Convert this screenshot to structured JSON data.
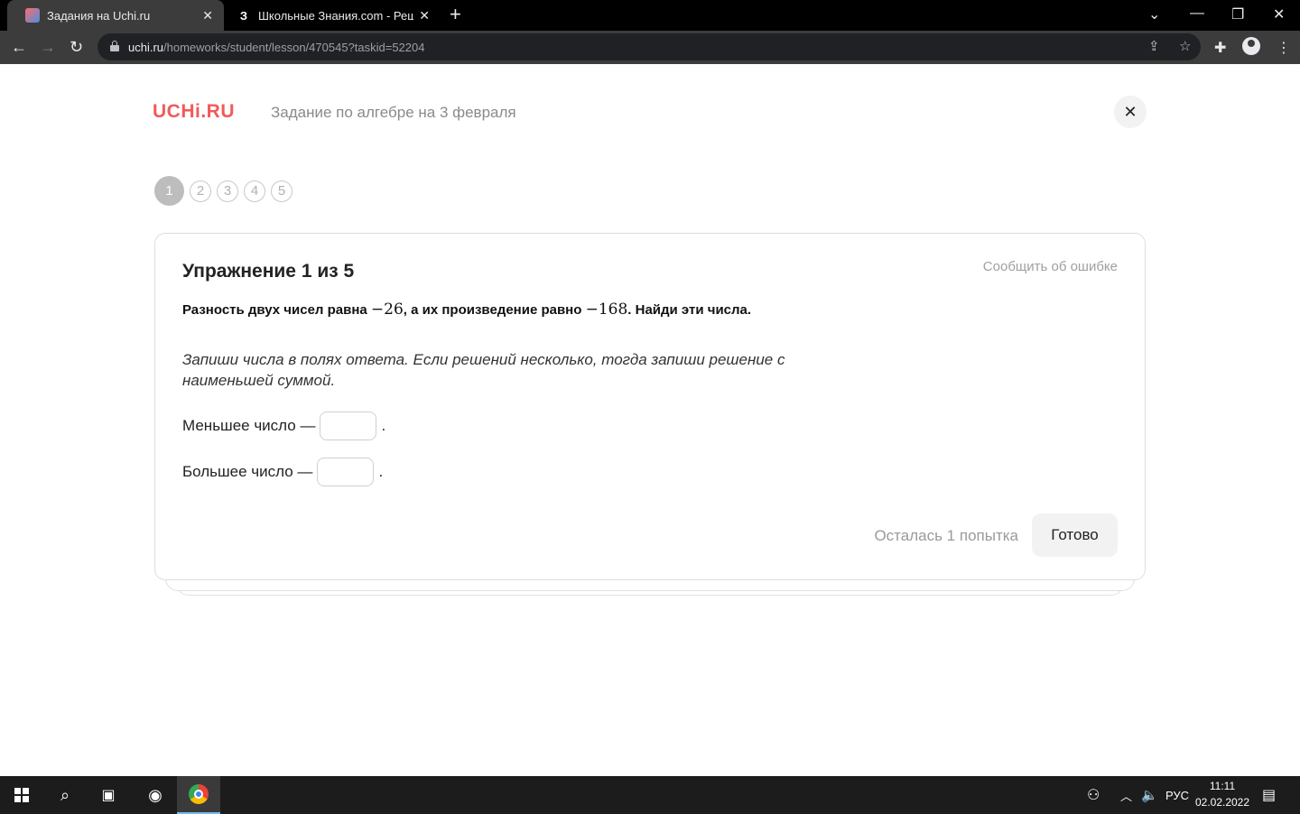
{
  "browser": {
    "tabs": [
      {
        "title": "Задания на Uchi.ru",
        "active": true
      },
      {
        "favicon_text": "З",
        "title": "Школьные Знания.com - Решае",
        "active": false
      }
    ],
    "url_host": "uchi.ru",
    "url_path": "/homeworks/student/lesson/470545?taskid=52204"
  },
  "page": {
    "logo": "UCHi.RU",
    "title": "Задание по алгебре на 3 февраля",
    "steps": [
      "1",
      "2",
      "3",
      "4",
      "5"
    ],
    "exercise": {
      "title": "Упражнение 1 из 5",
      "report_link": "Сообщить об ошибке",
      "task_part1": "Разность двух чисел равна ",
      "task_num1": "−26",
      "task_part2": ", а их произведение равно ",
      "task_num2": "−168",
      "task_part3": ". Найди эти числа.",
      "hint": "Запиши числа в полях ответа. Если решений несколько, тогда запиши решение с наименьшей суммой.",
      "smaller_label": "Меньшее число —",
      "larger_label": "Большее число —",
      "period": ".",
      "attempts": "Осталась 1 попытка",
      "submit": "Готово"
    }
  },
  "taskbar": {
    "language": "РУС",
    "time": "11:11",
    "date": "02.02.2022"
  }
}
